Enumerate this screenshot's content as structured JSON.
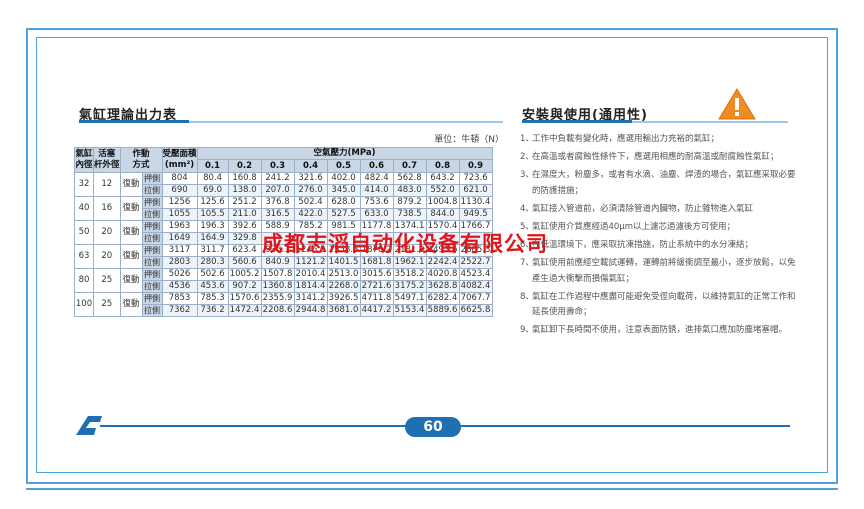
{
  "left_title": "氣缸理論出力表",
  "right_title": "安裝與使用(通用性)",
  "unit_note": "單位：牛頓（N）",
  "table": {
    "h_cyl_1": "氣缸",
    "h_cyl_2": "內徑",
    "h_rod_1": "活塞",
    "h_rod_2": "杆外徑",
    "h_act_1": "作動",
    "h_act_2": "方式",
    "h_area_1": "受壓面積",
    "h_area_2": "(mm²)",
    "h_pressure": "空氣壓力(MPa)",
    "pressures": [
      "0.1",
      "0.2",
      "0.3",
      "0.4",
      "0.5",
      "0.6",
      "0.7",
      "0.8",
      "0.9"
    ],
    "rows": [
      {
        "cyl": "32",
        "rod": "12",
        "act": "復動",
        "push": {
          "label": "押側",
          "area": "804",
          "v": [
            "80.4",
            "160.8",
            "241.2",
            "321.6",
            "402.0",
            "482.4",
            "562.8",
            "643.2",
            "723.6"
          ]
        },
        "pull": {
          "label": "拉側",
          "area": "690",
          "v": [
            "69.0",
            "138.0",
            "207.0",
            "276.0",
            "345.0",
            "414.0",
            "483.0",
            "552.0",
            "621.0"
          ]
        }
      },
      {
        "cyl": "40",
        "rod": "16",
        "act": "復動",
        "push": {
          "label": "押側",
          "area": "1256",
          "v": [
            "125.6",
            "251.2",
            "376.8",
            "502.4",
            "628.0",
            "753.6",
            "879.2",
            "1004.8",
            "1130.4"
          ]
        },
        "pull": {
          "label": "拉側",
          "area": "1055",
          "v": [
            "105.5",
            "211.0",
            "316.5",
            "422.0",
            "527.5",
            "633.0",
            "738.5",
            "844.0",
            "949.5"
          ]
        }
      },
      {
        "cyl": "50",
        "rod": "20",
        "act": "復動",
        "push": {
          "label": "押側",
          "area": "1963",
          "v": [
            "196.3",
            "392.6",
            "588.9",
            "785.2",
            "981.5",
            "1177.8",
            "1374.1",
            "1570.4",
            "1766.7"
          ]
        },
        "pull": {
          "label": "拉側",
          "area": "1649",
          "v": [
            "164.9",
            "329.8",
            "",
            "",
            "",
            "",
            "",
            "",
            ""
          ]
        }
      },
      {
        "cyl": "63",
        "rod": "20",
        "act": "復動",
        "push": {
          "label": "押側",
          "area": "3117",
          "v": [
            "311.7",
            "623.4",
            "935.1",
            "1246.8",
            "1558.5",
            "1870.2",
            "2181.9",
            "2493.6",
            "2805.3"
          ]
        },
        "pull": {
          "label": "拉側",
          "area": "2803",
          "v": [
            "280.3",
            "560.6",
            "840.9",
            "1121.2",
            "1401.5",
            "1681.8",
            "1962.1",
            "2242.4",
            "2522.7"
          ]
        }
      },
      {
        "cyl": "80",
        "rod": "25",
        "act": "復動",
        "push": {
          "label": "押側",
          "area": "5026",
          "v": [
            "502.6",
            "1005.2",
            "1507.8",
            "2010.4",
            "2513.0",
            "3015.6",
            "3518.2",
            "4020.8",
            "4523.4"
          ]
        },
        "pull": {
          "label": "拉側",
          "area": "4536",
          "v": [
            "453.6",
            "907.2",
            "1360.8",
            "1814.4",
            "2268.0",
            "2721.6",
            "3175.2",
            "3628.8",
            "4082.4"
          ]
        }
      },
      {
        "cyl": "100",
        "rod": "25",
        "act": "復動",
        "push": {
          "label": "押側",
          "area": "7853",
          "v": [
            "785.3",
            "1570.6",
            "2355.9",
            "3141.2",
            "3926.5",
            "4711.8",
            "5497.1",
            "6282.4",
            "7067.7"
          ]
        },
        "pull": {
          "label": "拉側",
          "area": "7362",
          "v": [
            "736.2",
            "1472.4",
            "2208.6",
            "2944.8",
            "3681.0",
            "4417.2",
            "5153.4",
            "5889.6",
            "6625.8"
          ]
        }
      }
    ]
  },
  "watermark": "成都志滔自动化设备有限公司",
  "notes": [
    {
      "num": "1、",
      "text": "工作中負載有變化時，應選用輸出力充裕的氣缸；"
    },
    {
      "num": "2、",
      "text": "在高溫或者腐蝕性條件下，應選用相應的耐高溫或耐腐蝕性氣缸；"
    },
    {
      "num": "3、",
      "text": "在濕度大，粉塵多，或者有水滴、油塵、焊渣的場合，氣缸應采取必要的防護措施；"
    },
    {
      "num": "4、",
      "text": "氣缸接入管道前，必須清除管道內臟物，防止雜物進入氣缸"
    },
    {
      "num": "5、",
      "text": "氣缸使用介質應經過40μm以上濾芯過濾後方可使用；"
    },
    {
      "num": "6、",
      "text": "在低溫環境下，應采取抗凍措施，防止系統中的水分凍結；"
    },
    {
      "num": "7、",
      "text": "氣缸使用前應經空載試運轉，運轉前將緩衝調至最小，逐步放鬆，以免產生過大衝擊而損傷氣缸；"
    },
    {
      "num": "8、",
      "text": "氣缸在工作過程中應盡可能避免受徑向載荷，以維持氣缸的正常工作和延長使用壽命；"
    },
    {
      "num": "9、",
      "text": "氣缸卸下長時間不使用，注意表面防銹，進排氣口應加防塵堵塞帽。"
    }
  ],
  "page_number": "60",
  "colors": {
    "frame": "#4aa3df",
    "accent_blue": "#1f6fb2",
    "warning": "#f08a24",
    "watermark": "#e3141a",
    "table_header": "#c8d6e6"
  }
}
